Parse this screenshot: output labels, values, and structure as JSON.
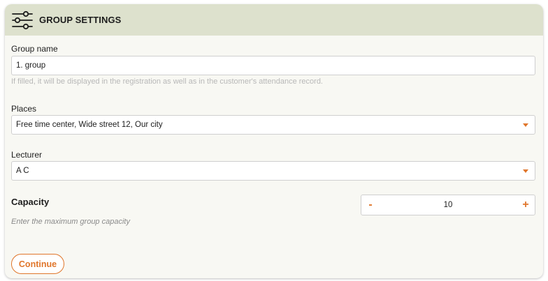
{
  "header": {
    "title": "GROUP SETTINGS",
    "icon": "sliders-icon"
  },
  "group_name": {
    "label": "Group name",
    "value": "1. group",
    "hint": "If filled, it will be displayed in the registration as well as in the customer's attendance record."
  },
  "places": {
    "label": "Places",
    "selected": "Free time center, Wide street 12, Our city"
  },
  "lecturer": {
    "label": "Lecturer",
    "selected": "A C"
  },
  "capacity": {
    "title": "Capacity",
    "hint": "Enter the maximum group capacity",
    "value": "10",
    "decrement": "-",
    "increment": "+"
  },
  "actions": {
    "continue_label": "Continue"
  },
  "colors": {
    "header_bg": "#dde1cd",
    "card_bg": "#f8f8f3",
    "accent": "#e0762b"
  }
}
